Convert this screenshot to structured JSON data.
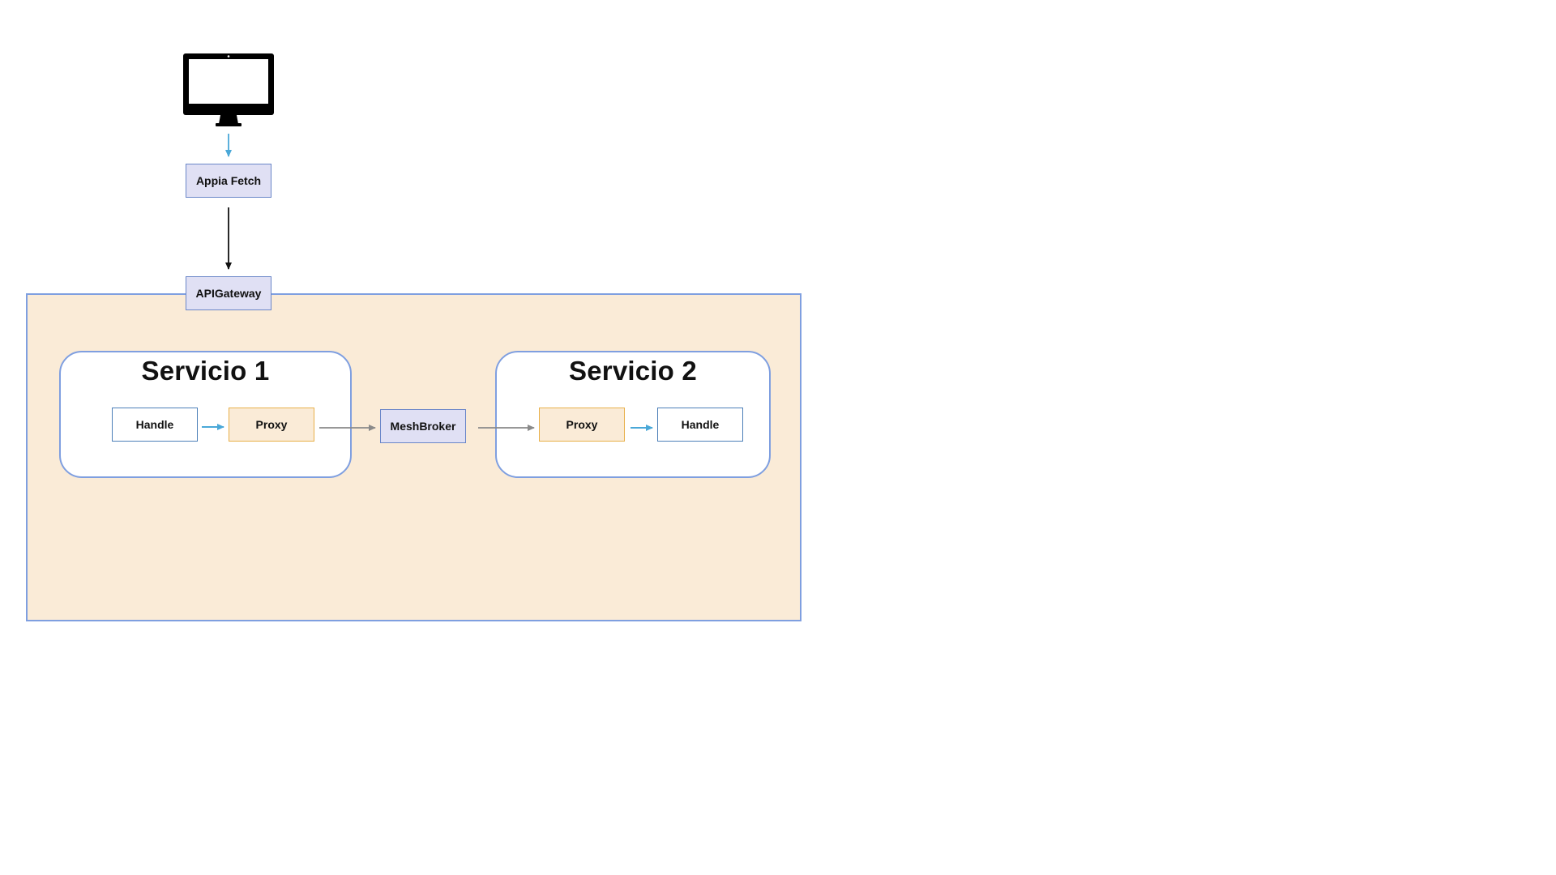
{
  "client": {
    "icon": "computer-monitor-icon"
  },
  "nodes": {
    "appia_fetch": "Appia Fetch",
    "api_gateway": "APIGateway",
    "mesh_broker": "MeshBroker"
  },
  "services": [
    {
      "title": "Servicio 1",
      "handle": "Handle",
      "proxy": "Proxy"
    },
    {
      "title": "Servicio 2",
      "proxy": "Proxy",
      "handle": "Handle"
    }
  ],
  "colors": {
    "mesh_background": "#faebd7",
    "container_border": "#7f9fe0",
    "lavender_fill": "#e0e0f4",
    "proxy_border": "#e8b04a",
    "handle_border": "#4c7fb8",
    "arrow_blue": "#4aa8d8",
    "arrow_gray": "#8a8a8a",
    "arrow_black": "#111111"
  }
}
